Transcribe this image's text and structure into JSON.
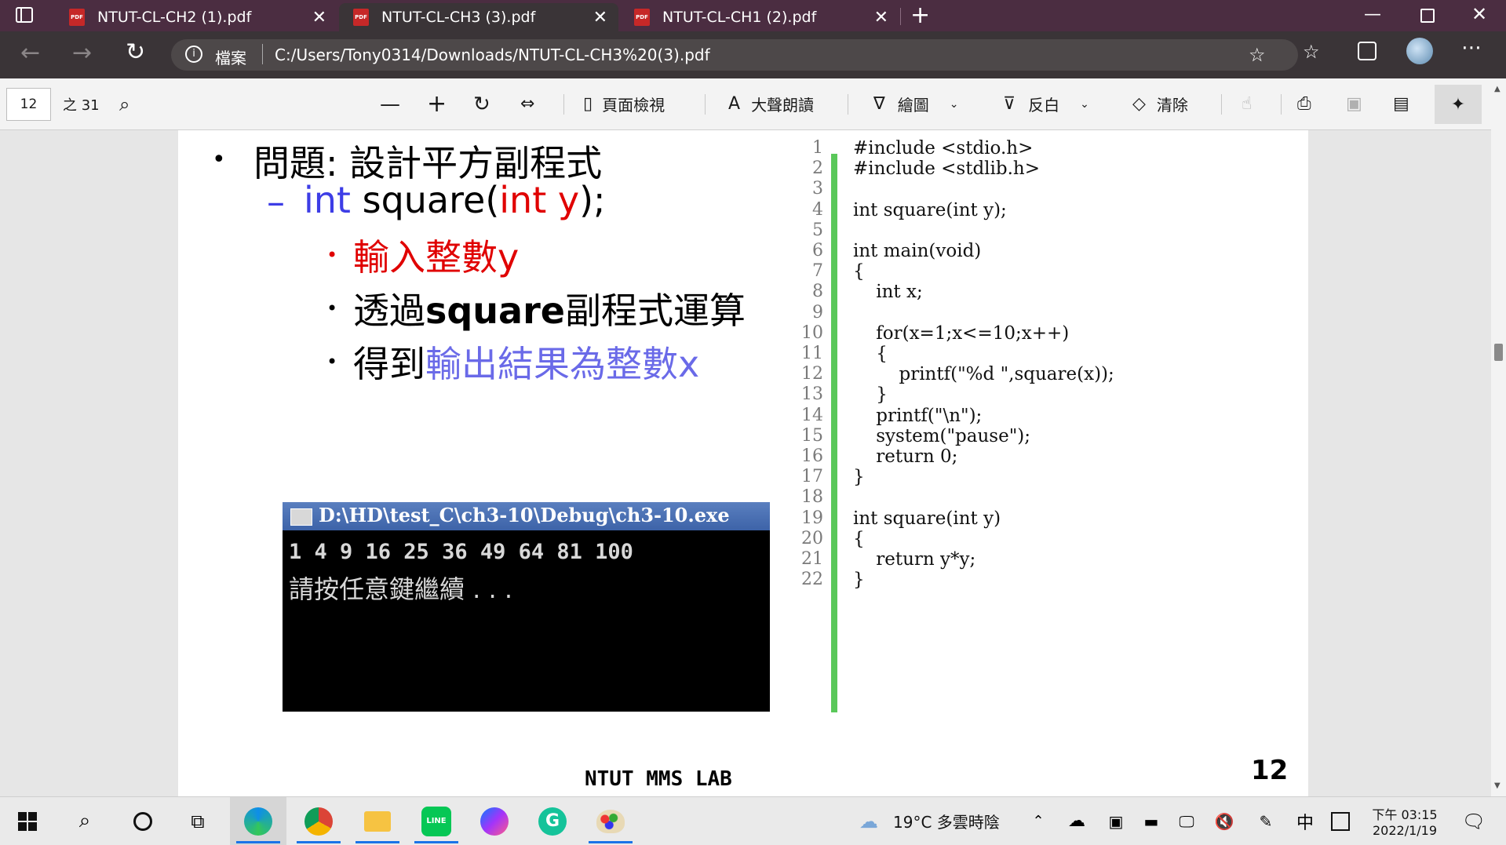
{
  "tabs": [
    {
      "title": "NTUT-CL-CH2 (1).pdf",
      "active": false
    },
    {
      "title": "NTUT-CL-CH3 (3).pdf",
      "active": true
    },
    {
      "title": "NTUT-CL-CH1 (2).pdf",
      "active": false
    }
  ],
  "address": {
    "site_label": "檔案",
    "url": "C:/Users/Tony0314/Downloads/NTUT-CL-CH3%20(3).pdf"
  },
  "pdf_toolbar": {
    "page_number": "12",
    "page_total": "之 31",
    "page_view_label": "頁面檢視",
    "read_aloud_label": "大聲朗讀",
    "draw_label": "繪圖",
    "highlight_label": "反白",
    "erase_label": "清除"
  },
  "slide": {
    "bullet1": "問題: 設計平方副程式",
    "prototype": {
      "kw1": "int",
      "fn": "square(",
      "kw2": "int",
      "param": "y",
      "end": ");"
    },
    "sub1": "輸入整數y",
    "sub2": {
      "a": "透過",
      "b": "square",
      "c": "副程式運算"
    },
    "sub3": {
      "a": "得到",
      "b": "輸出結果為整數x"
    },
    "console": {
      "title": "D:\\HD\\test_C\\ch3-10\\Debug\\ch3-10.exe",
      "line1": "1 4 9 16 25 36 49 64 81 100",
      "line2": "請按任意鍵繼續 . . ."
    },
    "code_lines": [
      {
        "n": "1",
        "text": "#include <stdio.h>"
      },
      {
        "n": "2",
        "text": "#include <stdlib.h>"
      },
      {
        "n": "3",
        "text": ""
      },
      {
        "n": "4",
        "text": "int square(int y);"
      },
      {
        "n": "5",
        "text": ""
      },
      {
        "n": "6",
        "text": "int main(void)"
      },
      {
        "n": "7",
        "text": "{"
      },
      {
        "n": "8",
        "text": "    int x;"
      },
      {
        "n": "9",
        "text": ""
      },
      {
        "n": "10",
        "text": "    for(x=1;x<=10;x++)"
      },
      {
        "n": "11",
        "text": "    {"
      },
      {
        "n": "12",
        "text": "        printf(\"%d \",square(x));"
      },
      {
        "n": "13",
        "text": "    }"
      },
      {
        "n": "14",
        "text": "    printf(\"\\n\");"
      },
      {
        "n": "15",
        "text": "    system(\"pause\");"
      },
      {
        "n": "16",
        "text": "    return 0;"
      },
      {
        "n": "17",
        "text": "}"
      },
      {
        "n": "18",
        "text": ""
      },
      {
        "n": "19",
        "text": "int square(int y)"
      },
      {
        "n": "20",
        "text": "{"
      },
      {
        "n": "21",
        "text": "    return y*y;"
      },
      {
        "n": "22",
        "text": "}"
      }
    ],
    "footer": "NTUT MMS LAB",
    "page_no": "12"
  },
  "taskbar": {
    "weather": "19°C  多雲時陰",
    "ime": "中",
    "time": "下午 03:15",
    "date": "2022/1/19",
    "line_label": "LINE"
  },
  "colors": {
    "tab_bar": "#4b2d41",
    "address_bar": "#3a3437",
    "accent_blue": "#3d3de6",
    "red": "#e00000",
    "light_blue": "#6a6ae8",
    "code_green": "#5ac85a"
  }
}
